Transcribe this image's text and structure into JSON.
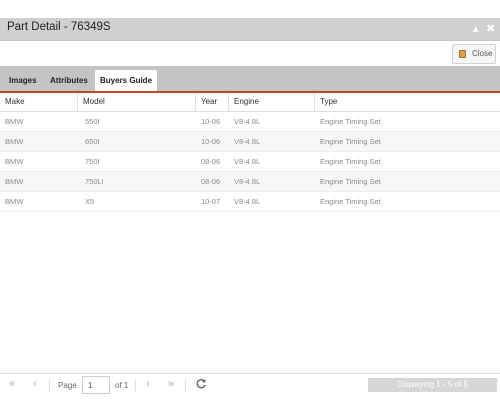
{
  "window": {
    "title": "Part Detail - 76349S",
    "minimize_glyph": "▴",
    "close_glyph": "✖"
  },
  "toolbar": {
    "close_label": "Close"
  },
  "tabs": [
    {
      "label": "Images",
      "active": false
    },
    {
      "label": "Attributes",
      "active": false
    },
    {
      "label": "Buyers Guide",
      "active": true
    }
  ],
  "grid": {
    "columns": [
      "Make",
      "Model",
      "Year",
      "Engine",
      "Type"
    ],
    "rows": [
      [
        "BMW",
        "550I",
        "10-06",
        "V8-4.8L",
        "Engine Timing Set"
      ],
      [
        "BMW",
        "650I",
        "10-06",
        "V8-4.8L",
        "Engine Timing Set"
      ],
      [
        "BMW",
        "750I",
        "08-06",
        "V8-4.8L",
        "Engine Timing Set"
      ],
      [
        "BMW",
        "750LI",
        "08-06",
        "V8-4.8L",
        "Engine Timing Set"
      ],
      [
        "BMW",
        "X5",
        "10-07",
        "V8-4.8L",
        "Engine Timing Set"
      ]
    ]
  },
  "pager": {
    "first_glyph": "«",
    "prev_glyph": "‹",
    "next_glyph": "›",
    "last_glyph": "»",
    "page_label": "Page",
    "page_value": "1",
    "of_label": "of 1",
    "display_text": "Displaying 1 - 5 of 5"
  },
  "colors": {
    "accent": "#c2452b",
    "titlebar": "#d0d0d0",
    "tabstrip": "#c4c4c4"
  }
}
